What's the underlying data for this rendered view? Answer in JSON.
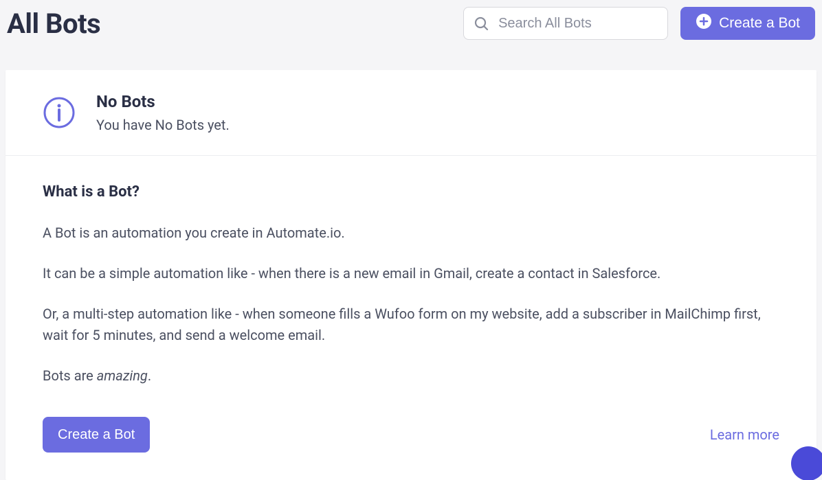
{
  "header": {
    "title": "All Bots",
    "search_placeholder": "Search All Bots",
    "create_button_label": "Create a Bot"
  },
  "panel": {
    "empty_title": "No Bots",
    "empty_subtitle": "You have No Bots yet.",
    "info_heading": "What is a Bot?",
    "paragraphs": {
      "p1": "A Bot is an automation you create in Automate.io.",
      "p2": "It can be a simple automation like - when there is a new email in Gmail, create a contact in Salesforce.",
      "p3": "Or, a multi-step automation like - when someone fills a Wufoo form on my website, add a subscriber in MailChimp first, wait for 5 minutes, and send a welcome email.",
      "p4_prefix": "Bots are ",
      "p4_em": "amazing",
      "p4_suffix": "."
    },
    "create_button_label": "Create a Bot",
    "learn_more_label": "Learn more"
  },
  "colors": {
    "accent": "#6b6ce0"
  }
}
